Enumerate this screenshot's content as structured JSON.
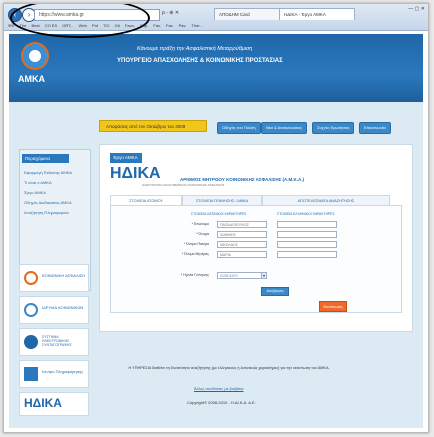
{
  "browser": {
    "address": "https://www.amka.gr",
    "address_tail": "ρ - ⊕ ✕",
    "tabs": [
      "ΑΠΟΔΗΜ Card",
      "ΗΔΙΚΑ - Έργο ΑΜΚΑ"
    ],
    "favorites": [
      "ΦΦ",
      "The",
      "Best",
      "CO ES",
      "GRT...",
      "Web",
      "Pnf",
      "TCI",
      "Git",
      "Favo.",
      "Sup.",
      "Fav.",
      "Fav.",
      "Pav.",
      "Ther..."
    ],
    "window_controls": "— ▢ ✕"
  },
  "banner": {
    "logo_text": "ΑΜΚΑ",
    "title": "Κάνουμε πράξη την Ασφαλιστική Μεταρρύθμιση",
    "subtitle": "ΥΠΟΥΡΓΕΙΟ ΑΠΑΣΧΟΛΗΣΗΣ & ΚΟΙΝΩΝΙΚΗΣ ΠΡΟΣΤΑΣΙΑΣ"
  },
  "info_box": "Αποφάσεις από τον Οκτώβριο του 2009",
  "top_nav": [
    "Οδηγός του Πολίτη",
    "Νέα & Ανακοινώσεις",
    "Συχνές Ερωτήσεις",
    "Επικοινωνία"
  ],
  "sidebar": {
    "header": "Περιεχόμενα",
    "items": [
      "Εφαρμογή Έκδοσης ΑΜΚΑ",
      "Τι είναι ο ΑΜΚΑ",
      "Έργο ΑΜΚΑ",
      "Οδηγός Διαδικασίας ΑΜΚΑ",
      "Αναζήτηση Πληροφοριών"
    ],
    "logos": [
      "ΚΟΙΝΩΝΙΚΗ ΑΣΦΑΛΙΣΗ",
      "ΙΔΡΥΜΑ ΚΟΙΝΩΝΙΚΩΝ",
      "ΣΥΣΤΗΜΑ ΗΛΕΚΤΡΟΝΙΚΗΣ ΣΥΝΤΑΓΟΓΡΑΦΗΣ",
      "Κέντρο Πληροφόρησης"
    ]
  },
  "panel": {
    "badge": "Έργο ΑΜΚΑ",
    "brand": "ΗΔΙΚΑ",
    "brand_sub": "ΗΛΕΚΤΡΟΝΙΚΗ ΔΙΑΚΥΒΕΡΝΗΣΗ ΚΟΙΝΩΝΙΚΗΣ ΑΣΦΑΛΙΣΗΣ",
    "title": "ΑΡΙΘΜΟΣ ΜΗΤΡΩΟΥ ΚΟΙΝΩΝΙΚΗΣ ΑΣΦΑΛΙΣΗΣ (Α.Μ.Κ.Α.)",
    "tabs": [
      "ΣΤΟΙΧΕΙΑ ΑΤΟΜΟΥ",
      "ΣΤΟΙΧΕΙΑ ΓΕΝΝΗΣΗΣ / ΑΜΚΑ",
      "ΑΠΟΤΕΛΕΣΜΑΤΑ ΑΝΑΖΗΤΗΣΗΣ"
    ],
    "col_latin": "ΣΤΟΙΧΕΙΑ ΛΑΤΙΝΙΚΟΙ ΧΑΡΑΚΤΗΡΕΣ",
    "col_greek": "ΣΤΟΙΧΕΙΑ ΕΛΛΗΝΙΚΟΙ ΧΑΡΑΚΤΗΡΕΣ",
    "fields": [
      {
        "label": "* Επώνυμο",
        "latin": "ΠΑΠΑΔΟΠΟΥΛΟΣ",
        "greek": ""
      },
      {
        "label": "* Όνομα",
        "latin": "ΙΩΑΝΝΗΣ",
        "greek": ""
      },
      {
        "label": "* Όνομα Πατέρα",
        "latin": "ΝΙΚΟΛΑΟΣ",
        "greek": ""
      },
      {
        "label": "* Όνομα Μητέρας",
        "latin": "ΜΑΡΙΑ",
        "greek": ""
      }
    ],
    "birth_label": "* Ημ/νία Γέννησης",
    "birth_value": "01/01/1970",
    "search_btn": "Αναζήτηση",
    "submit_btn": "Εκτύπωση"
  },
  "footer": {
    "note": "Η ΥΠΗΡΕΣΙΑ διαθέτει τη δυνατότητα αναζήτησης (με ελληνικούς ή λατινικούς χαρακτήρες) για την εκτύπωση του ΑΜΚΑ.",
    "link": "Άλλες συνδέσεις με βοήθεια",
    "copyright": "Copyright© 2008-2010 - Η.ΔΙ.Κ.Α. Α.Ε."
  }
}
